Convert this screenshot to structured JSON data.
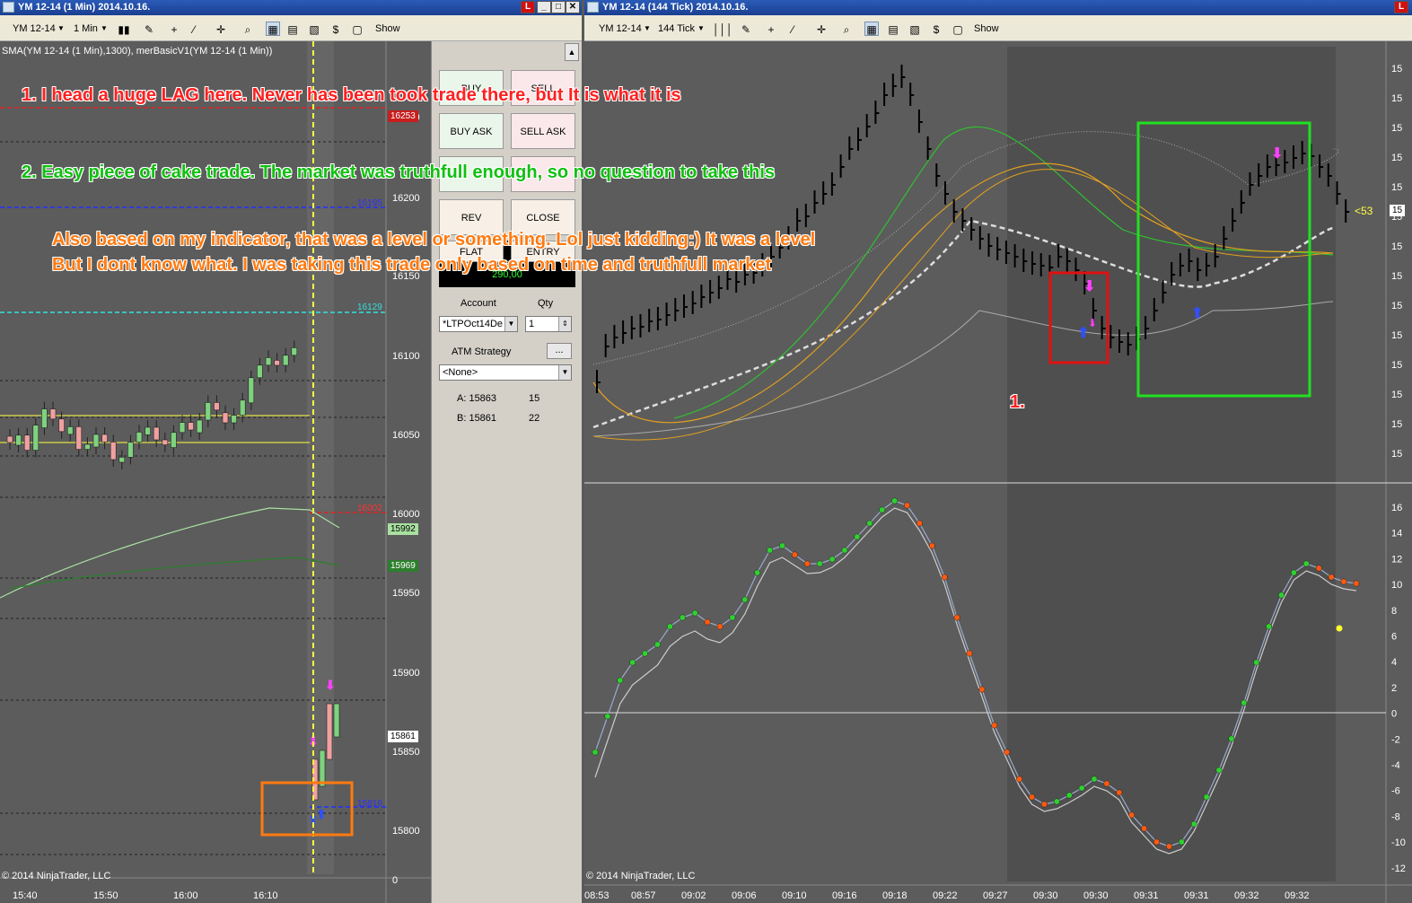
{
  "left_window": {
    "title": "YM 12-14 (1 Min)  2014.10.16.",
    "toolbar": {
      "instrument": "YM 12-14",
      "interval": "1 Min",
      "show_label": "Show"
    },
    "indicator_label": "SMA(YM 12-14 (1 Min),1300), merBasicV1(YM 12-14 (1 Min))",
    "price_axis": [
      "16250",
      "16200",
      "16150",
      "16100",
      "16050",
      "16000",
      "15950",
      "15900",
      "15850",
      "15800",
      "0"
    ],
    "time_axis": [
      "15:40",
      "15:50",
      "16:00",
      "16:10"
    ],
    "price_boxes": [
      "16253",
      "15992",
      "15969",
      "15861"
    ],
    "line_labels": [
      "16195",
      "16129",
      "16002",
      "15816"
    ],
    "copyright": "© 2014 NinjaTrader, LLC"
  },
  "order_panel": {
    "buy_label": "BUY",
    "sell_label": "SELL",
    "buy_ask_label": "BUY ASK",
    "sell_ask_label": "SELL ASK",
    "rev_label": "REV",
    "close_label": "CLOSE",
    "flat_label": "FLAT",
    "entry_label": "ENTRY",
    "pnl": "290,00",
    "account_label": "Account",
    "qty_label": "Qty",
    "account_value": "*LTPOct14De",
    "qty_value": "1",
    "atm_label": "ATM Strategy",
    "atm_btn": "...",
    "atm_value": "<None>",
    "ask": "A: 15863",
    "ask_size": "15",
    "bid": "B: 15861",
    "bid_size": "22"
  },
  "right_window": {
    "title": "YM 12-14 (144 Tick)  2014.10.16.",
    "toolbar": {
      "instrument": "YM 12-14",
      "interval": "144 Tick",
      "show_label": "Show"
    },
    "price_axis": [
      "15",
      "15",
      "15",
      "15",
      "15",
      "15",
      "15",
      "15",
      "15",
      "15",
      "15",
      "15",
      "15",
      "15"
    ],
    "osc_axis": [
      "16",
      "14",
      "12",
      "10",
      "8",
      "6",
      "4",
      "2",
      "0",
      "-2",
      "-4",
      "-6",
      "-8",
      "-10",
      "-12"
    ],
    "time_axis": [
      "08:53",
      "08:57",
      "09:02",
      "09:06",
      "09:10",
      "09:16",
      "09:18",
      "09:22",
      "09:27",
      "09:30",
      "09:30",
      "09:31",
      "09:31",
      "09:32",
      "09:32"
    ],
    "price_tag": "15",
    "price_marker": "<53",
    "copyright": "© 2014 NinjaTrader, LLC"
  },
  "annotations": {
    "note1": "1. I head a huge LAG here. Never has been took trade there, but It is what it is",
    "note2": "2. Easy piece of cake trade. The market was truthfull enough, so no question to take this",
    "note3_line1": "Also based on my indicator, that was a level or something. Lol just kidding:) It was a level",
    "note3_line2": "But I dont know what. I was taking this trade only based on time and truthfull market",
    "marker1": "1.",
    "colors": {
      "note1": "#ff2020",
      "note2": "#10c010",
      "note3": "#ff7a10"
    }
  }
}
